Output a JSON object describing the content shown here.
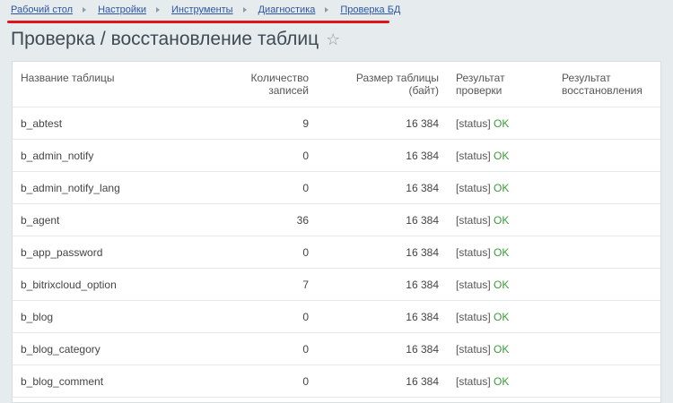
{
  "breadcrumb": [
    {
      "label": "Рабочий стол"
    },
    {
      "label": "Настройки"
    },
    {
      "label": "Инструменты"
    },
    {
      "label": "Диагностика"
    },
    {
      "label": "Проверка БД"
    }
  ],
  "page": {
    "title": "Проверка / восстановление таблиц",
    "star_icon": "☆"
  },
  "table": {
    "headers": {
      "name": "Название таблицы",
      "records": "Количество записей",
      "size": "Размер таблицы (байт)",
      "check": "Результат проверки",
      "restore": "Результат восстановления"
    },
    "rows": [
      {
        "name": "b_abtest",
        "records": "9",
        "size": "16 384",
        "status_prefix": "[status]",
        "status": "OK"
      },
      {
        "name": "b_admin_notify",
        "records": "0",
        "size": "16 384",
        "status_prefix": "[status]",
        "status": "OK"
      },
      {
        "name": "b_admin_notify_lang",
        "records": "0",
        "size": "16 384",
        "status_prefix": "[status]",
        "status": "OK"
      },
      {
        "name": "b_agent",
        "records": "36",
        "size": "16 384",
        "status_prefix": "[status]",
        "status": "OK"
      },
      {
        "name": "b_app_password",
        "records": "0",
        "size": "16 384",
        "status_prefix": "[status]",
        "status": "OK"
      },
      {
        "name": "b_bitrixcloud_option",
        "records": "7",
        "size": "16 384",
        "status_prefix": "[status]",
        "status": "OK"
      },
      {
        "name": "b_blog",
        "records": "0",
        "size": "16 384",
        "status_prefix": "[status]",
        "status": "OK"
      },
      {
        "name": "b_blog_category",
        "records": "0",
        "size": "16 384",
        "status_prefix": "[status]",
        "status": "OK"
      },
      {
        "name": "b_blog_comment",
        "records": "0",
        "size": "16 384",
        "status_prefix": "[status]",
        "status": "OK"
      }
    ]
  },
  "colors": {
    "link": "#2e569c",
    "ok": "#3c9a3c",
    "highlight": "#e0131a"
  }
}
